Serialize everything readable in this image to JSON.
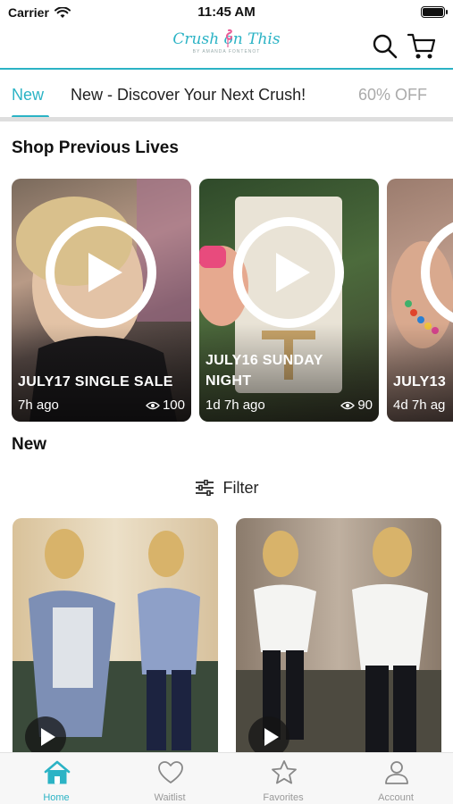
{
  "status_bar": {
    "carrier": "Carrier",
    "time": "11:45 AM"
  },
  "brand": {
    "logo_text": "Crush on This",
    "logo_sub": "BY AMANDA FONTENOT",
    "accent_color": "#2bb3c5"
  },
  "tabs": [
    {
      "label": "New",
      "active": true
    },
    {
      "label": "New  - Discover Your Next Crush!",
      "active": false
    },
    {
      "label": "60% OFF",
      "active": false
    }
  ],
  "sections": {
    "lives_title": "Shop Previous Lives",
    "new_title": "New"
  },
  "lives": [
    {
      "title_line1": "JULY17 SINGLE SALE",
      "title_line2": "",
      "time": "7h ago",
      "views": "100"
    },
    {
      "title_line1": "JULY16 SUNDAY",
      "title_line2": "NIGHT",
      "time": "1d 7h ago",
      "views": "90"
    },
    {
      "title_line1": "JULY13",
      "title_line2": "",
      "time": "4d 7h ag",
      "views": ""
    }
  ],
  "filter": {
    "label": "Filter"
  },
  "bottom_nav": [
    {
      "label": "Home",
      "icon": "home-icon",
      "active": true
    },
    {
      "label": "Waitlist",
      "icon": "heart-icon",
      "active": false
    },
    {
      "label": "Favorites",
      "icon": "star-icon",
      "active": false
    },
    {
      "label": "Account",
      "icon": "person-icon",
      "active": false
    }
  ]
}
